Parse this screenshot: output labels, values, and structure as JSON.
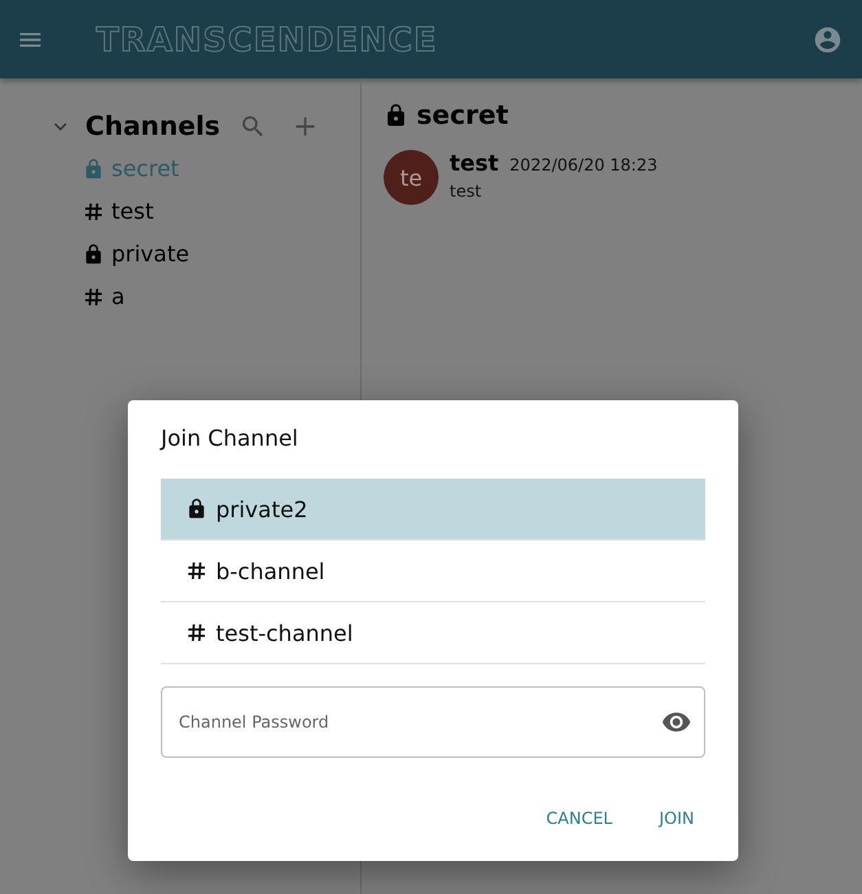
{
  "app_bar": {
    "logo": "TRANSCENDENCE"
  },
  "sidebar": {
    "title": "Channels",
    "expanded": true,
    "channels": [
      {
        "name": "secret",
        "kind": "locked",
        "selected": true
      },
      {
        "name": "test",
        "kind": "public",
        "selected": false
      },
      {
        "name": "private",
        "kind": "locked",
        "selected": false
      },
      {
        "name": "a",
        "kind": "public",
        "selected": false
      }
    ]
  },
  "chat": {
    "title": "secret",
    "kind": "locked",
    "messages": [
      {
        "avatar": "te",
        "color": "#4f1f1a",
        "author": "test",
        "time": "2022/06/20 18:23",
        "text": "test"
      }
    ]
  },
  "dialog": {
    "title": "Join Channel",
    "channels": [
      {
        "name": "private2",
        "kind": "locked",
        "selected": true
      },
      {
        "name": "b-channel",
        "kind": "public",
        "selected": false
      },
      {
        "name": "test-channel",
        "kind": "public",
        "selected": false
      }
    ],
    "password": {
      "placeholder": "Channel Password"
    },
    "buttons": [
      "CANCEL",
      "JOIN"
    ]
  }
}
